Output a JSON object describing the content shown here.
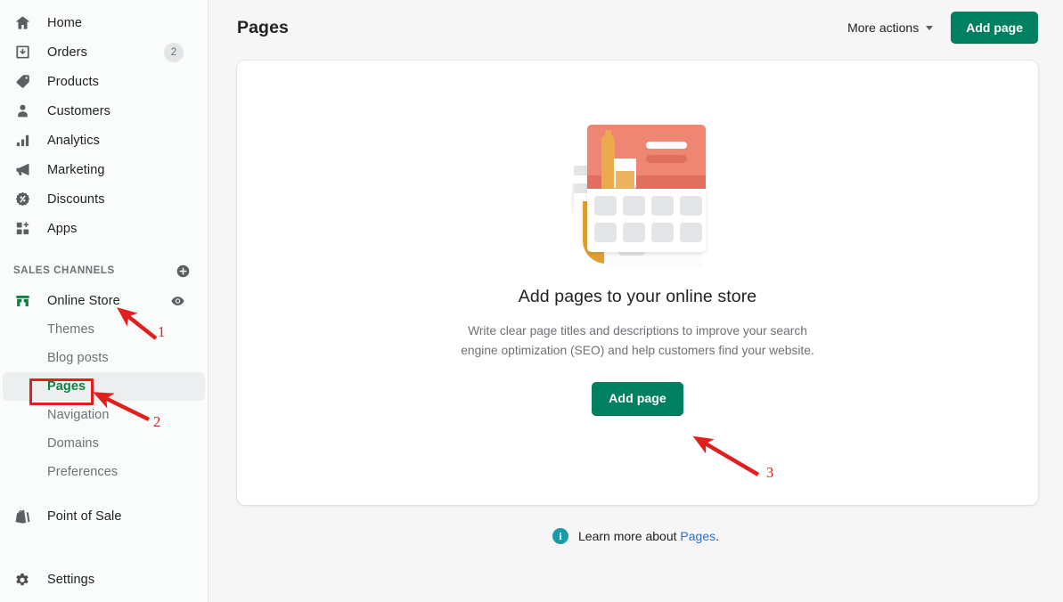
{
  "sidebar": {
    "main_items": [
      {
        "label": "Home",
        "icon": "home-icon",
        "badge": null
      },
      {
        "label": "Orders",
        "icon": "orders-inbox-icon",
        "badge": "2"
      },
      {
        "label": "Products",
        "icon": "product-tag-icon",
        "badge": null
      },
      {
        "label": "Customers",
        "icon": "customer-person-icon",
        "badge": null
      },
      {
        "label": "Analytics",
        "icon": "analytics-bar-chart-icon",
        "badge": null
      },
      {
        "label": "Marketing",
        "icon": "marketing-megaphone-icon",
        "badge": null
      },
      {
        "label": "Discounts",
        "icon": "discount-percent-icon",
        "badge": null
      },
      {
        "label": "Apps",
        "icon": "apps-grid-plus-icon",
        "badge": null
      }
    ],
    "sales_channels": {
      "heading": "SALES CHANNELS",
      "add_icon": "add-channel-plus-circle-icon",
      "online_store": {
        "label": "Online Store",
        "icon": "online-store-storefront-icon",
        "preview_icon": "preview-eye-icon"
      },
      "sub_items": [
        {
          "label": "Themes",
          "selected": false
        },
        {
          "label": "Blog posts",
          "selected": false
        },
        {
          "label": "Pages",
          "selected": true
        },
        {
          "label": "Navigation",
          "selected": false
        },
        {
          "label": "Domains",
          "selected": false
        },
        {
          "label": "Preferences",
          "selected": false
        }
      ]
    },
    "bottom_items": [
      {
        "label": "Point of Sale",
        "icon": "shopify-bag-icon"
      },
      {
        "label": "Settings",
        "icon": "settings-gear-icon"
      }
    ]
  },
  "header": {
    "title": "Pages",
    "more_actions_label": "More actions",
    "more_actions_icon": "chevron-down-icon",
    "add_page_label": "Add page"
  },
  "empty_state": {
    "illustration_name": "pages-empty-state-illustration",
    "title": "Add pages to your online store",
    "body": "Write clear page titles and descriptions to improve your search engine optimization (SEO) and help customers find your website.",
    "cta_label": "Add page"
  },
  "footer": {
    "info_icon": "info-circle-icon",
    "prefix": "Learn more about ",
    "link_label": "Pages",
    "suffix": "."
  },
  "annotations": {
    "color": "#e01f1f",
    "markers": [
      {
        "number": "1",
        "target": "Online Store"
      },
      {
        "number": "2",
        "target": "Pages"
      },
      {
        "number": "3",
        "target": "Add page"
      }
    ]
  },
  "colors": {
    "brand_green": "#008060",
    "selected_green": "#108043",
    "link_blue": "#2c6ecb",
    "annotation_red": "#e01f1f",
    "info_teal": "#1a9ba8",
    "canvas_gray": "#f6f6f7"
  }
}
